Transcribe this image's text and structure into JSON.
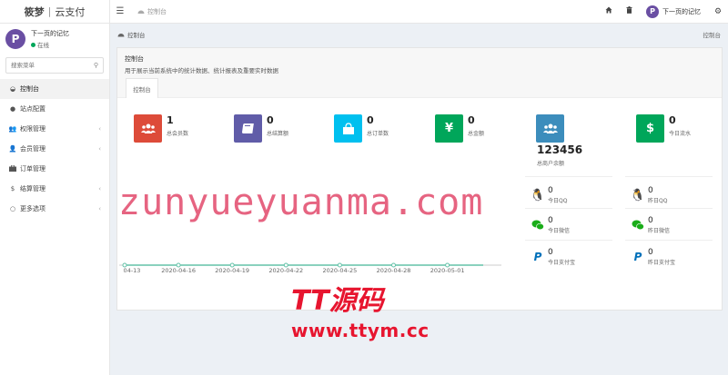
{
  "brand": {
    "name": "筱梦",
    "sep": "|",
    "suffix": "云支付"
  },
  "topbar": {
    "menu_icon": "menu-icon",
    "crumb": "控制台",
    "user_name": "下一页的记忆",
    "avatar_letter": "P"
  },
  "sidebar": {
    "user_name": "下一页的记忆",
    "status": "在线",
    "search_placeholder": "搜索菜单",
    "items": [
      {
        "label": "控制台",
        "icon": "dashboard-icon",
        "active": true
      },
      {
        "label": "站点配置",
        "icon": "circle-icon"
      },
      {
        "label": "权限管理",
        "icon": "users-icon",
        "has_children": true
      },
      {
        "label": "会员管理",
        "icon": "user-icon",
        "has_children": true
      },
      {
        "label": "订单管理",
        "icon": "briefcase-icon"
      },
      {
        "label": "结算管理",
        "icon": "dollar-icon",
        "has_children": true
      },
      {
        "label": "更多选项",
        "icon": "circle-outline-icon",
        "has_children": true
      }
    ]
  },
  "content": {
    "breadcrumb": "控制台",
    "breadcrumb_right": "控制台",
    "panel_title": "控制台",
    "panel_subtitle": "用于展示当前系统中的统计数据、统计报表及重要实时数据",
    "tab": "控制台"
  },
  "stats": [
    {
      "value": "1",
      "label": "总会员数",
      "color": "#dd4b39",
      "icon": "users-icon"
    },
    {
      "value": "0",
      "label": "总结算额",
      "color": "#605ca8",
      "icon": "book-icon"
    },
    {
      "value": "0",
      "label": "总订单数",
      "color": "#00c0ef",
      "icon": "shopping-bag-icon"
    },
    {
      "value": "0",
      "label": "总金额",
      "color": "#00a65a",
      "icon": "yen-icon"
    },
    {
      "value": "",
      "label": "",
      "color": "#3c8dbc",
      "icon": "users-icon"
    },
    {
      "value": "0",
      "label": "今日流水",
      "color": "#00a65a",
      "icon": "dollar-icon"
    }
  ],
  "balance": {
    "value": "123456",
    "label": "总商户余额"
  },
  "mini": [
    {
      "value": "0",
      "label": "今日QQ",
      "icon": "qq-icon",
      "color": "#1aad19"
    },
    {
      "value": "0",
      "label": "昨日QQ",
      "icon": "qq-icon",
      "color": "#1aad19"
    },
    {
      "value": "0",
      "label": "今日微信",
      "icon": "wechat-icon",
      "color": "#1aad19"
    },
    {
      "value": "0",
      "label": "昨日微信",
      "icon": "wechat-icon",
      "color": "#1aad19"
    },
    {
      "value": "0",
      "label": "今日支付宝",
      "icon": "paypal-icon",
      "color": "#0070ba"
    },
    {
      "value": "0",
      "label": "昨日支付宝",
      "icon": "paypal-icon",
      "color": "#0070ba"
    }
  ],
  "chart_data": {
    "type": "line",
    "x_ticks": [
      "04-13",
      "2020-04-16",
      "2020-04-19",
      "2020-04-22",
      "2020-04-25",
      "2020-04-28",
      "2020-05-01"
    ],
    "series": [
      {
        "values": [
          0,
          0,
          0,
          0,
          0,
          0,
          0,
          0,
          0,
          0,
          0,
          0,
          0,
          0,
          0,
          0,
          0,
          0,
          0,
          0,
          0
        ]
      }
    ],
    "color": "#63c2a8"
  },
  "watermark": {
    "line1": "zunyueyuanma.com",
    "line2": "TT源码",
    "line3": "www.ttym.cc"
  }
}
